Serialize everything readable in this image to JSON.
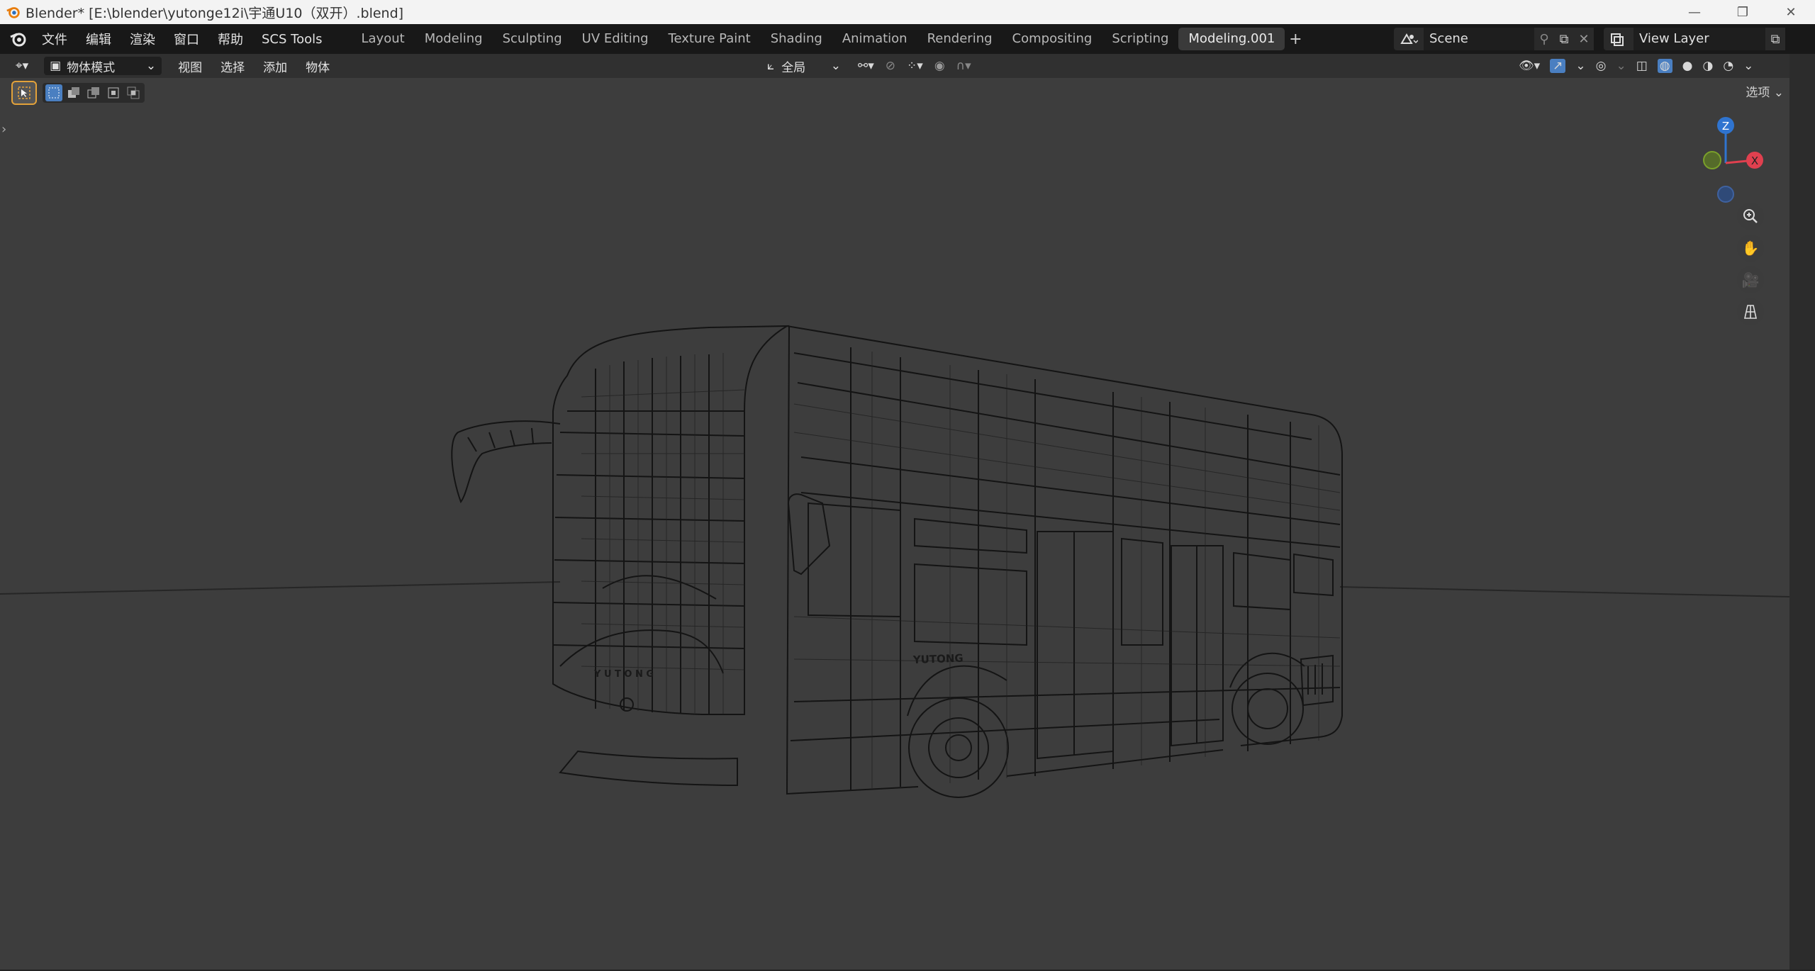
{
  "window": {
    "title": "Blender* [E:\\blender\\yutonge12i\\宇通U10（双开）.blend]",
    "controls": [
      "minimize",
      "restore",
      "close"
    ]
  },
  "menu": {
    "items": [
      "文件",
      "编辑",
      "渲染",
      "窗口",
      "帮助",
      "SCS Tools"
    ]
  },
  "workspaces": {
    "tabs": [
      "Layout",
      "Modeling",
      "Sculpting",
      "UV Editing",
      "Texture Paint",
      "Shading",
      "Animation",
      "Rendering",
      "Compositing",
      "Scripting",
      "Modeling.001"
    ],
    "active": "Modeling.001",
    "add_label": "+"
  },
  "scene": {
    "name": "Scene"
  },
  "view_layer": {
    "name": "View Layer"
  },
  "header": {
    "mode": "物体模式",
    "menus": [
      "视图",
      "选择",
      "添加",
      "物体"
    ],
    "orientation": "全局"
  },
  "viewport": {
    "options_label": "选项",
    "gizmo": {
      "z_label": "Z",
      "x_label": "X"
    },
    "model_brand": "YUTONG",
    "model_front_text": "Y U T O N G"
  },
  "colors": {
    "accent_active_tool": "#e3a23a",
    "axis_x": "#e0404f",
    "axis_y": "#7aa02a",
    "axis_z": "#2f74d0",
    "wire": "#111111",
    "viewport_bg": "#3d3d3d"
  }
}
